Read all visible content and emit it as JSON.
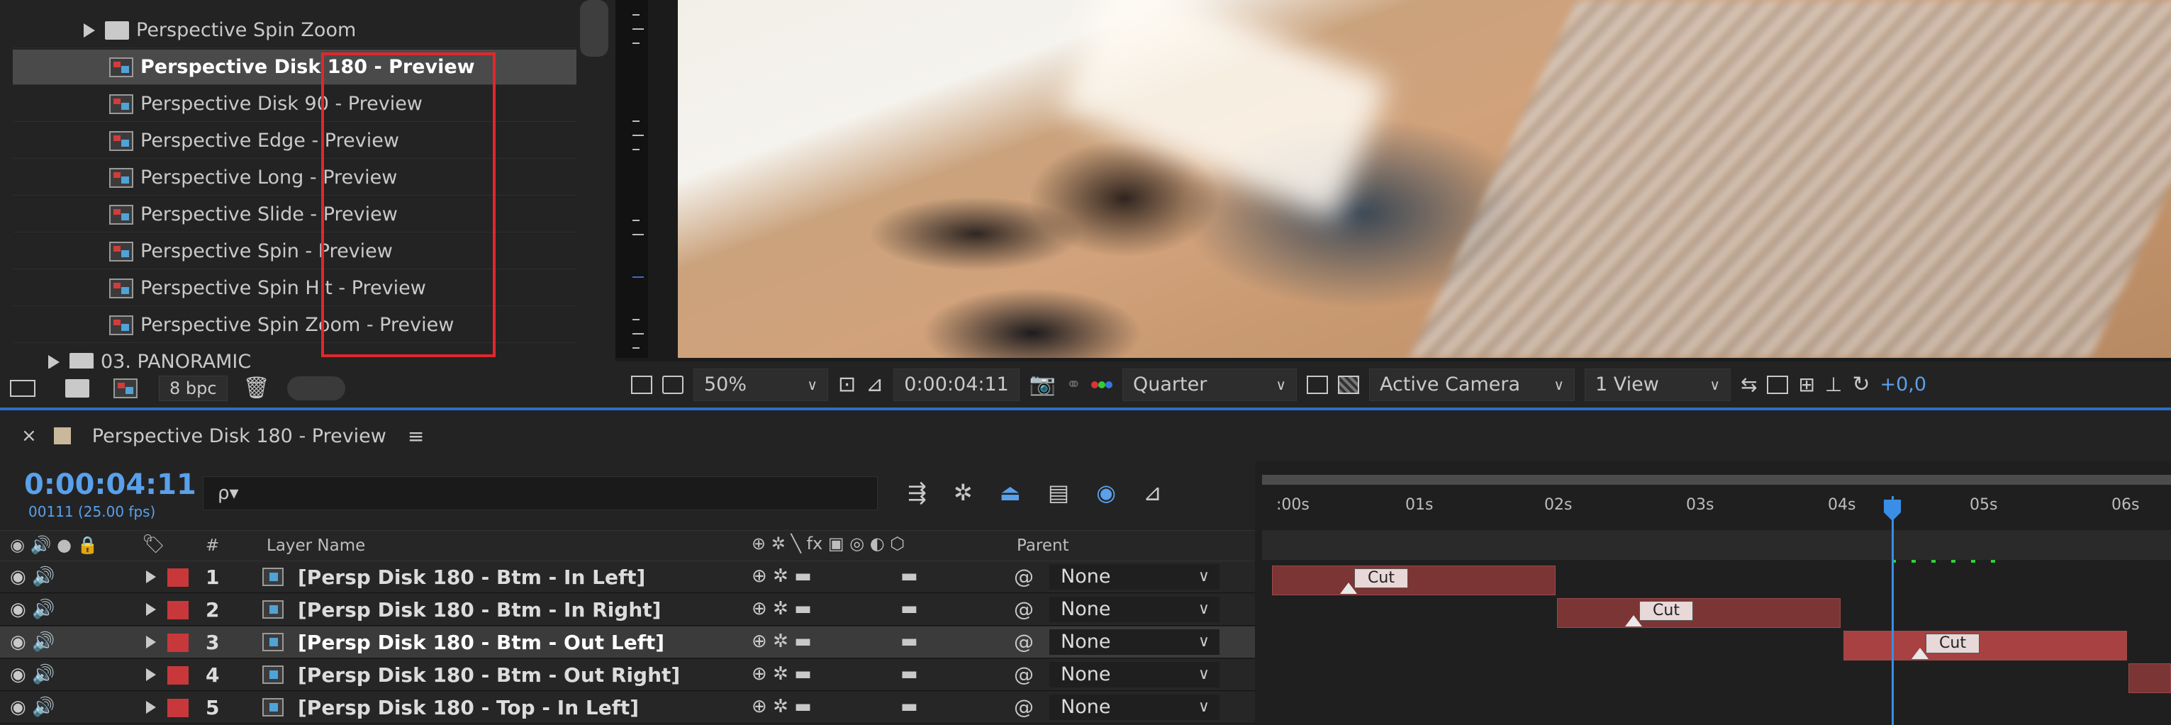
{
  "project": {
    "items": [
      {
        "label": "Perspective Spin Zoom",
        "kind": "folder"
      },
      {
        "label": "Perspective Disk 180 - Preview",
        "kind": "comp",
        "selected": true
      },
      {
        "label": "Perspective Disk 90 - Preview",
        "kind": "comp"
      },
      {
        "label": "Perspective Edge - Preview",
        "kind": "comp"
      },
      {
        "label": "Perspective Long - Preview",
        "kind": "comp"
      },
      {
        "label": "Perspective Slide - Preview",
        "kind": "comp"
      },
      {
        "label": "Perspective Spin - Preview",
        "kind": "comp"
      },
      {
        "label": "Perspective Spin Hit - Preview",
        "kind": "comp"
      },
      {
        "label": "Perspective Spin Zoom - Preview",
        "kind": "comp"
      },
      {
        "label": "03. PANORAMIC",
        "kind": "folder"
      }
    ],
    "footer": {
      "bpc": "8 bpc"
    }
  },
  "viewer_toolbar": {
    "zoom": "50%",
    "timecode": "0:00:04:11",
    "resolution": "Quarter",
    "camera": "Active Camera",
    "view": "1 View",
    "exposure": "+0,0"
  },
  "timeline": {
    "close": "×",
    "comp_name": "Perspective Disk 180 - Preview",
    "menu": "≡",
    "timecode": "0:00:04:11",
    "fps": "00111 (25.00 fps)",
    "search_placeholder": "ρ▾",
    "columns": {
      "hash": "#",
      "layer_name": "Layer Name",
      "parent": "Parent"
    },
    "ruler": [
      ":00s",
      "01s",
      "02s",
      "03s",
      "04s",
      "05s",
      "06s"
    ],
    "layers": [
      {
        "num": "1",
        "name": "[Persp Disk 180 - Btm - In Left]",
        "parent": "None"
      },
      {
        "num": "2",
        "name": "[Persp Disk 180 - Btm - In Right]",
        "parent": "None"
      },
      {
        "num": "3",
        "name": "[Persp Disk 180 - Btm - Out Left]",
        "parent": "None",
        "selected": true
      },
      {
        "num": "4",
        "name": "[Persp Disk 180 - Btm - Out Right]",
        "parent": "None"
      },
      {
        "num": "5",
        "name": "[Persp Disk 180 - Top - In Left]",
        "parent": "None"
      }
    ],
    "marker_label": "Cut"
  },
  "colors": {
    "accent": "#2c6fc9",
    "timecode": "#5aa0ea",
    "label_red": "#c8383b",
    "highlight_box": "#e0282d"
  }
}
